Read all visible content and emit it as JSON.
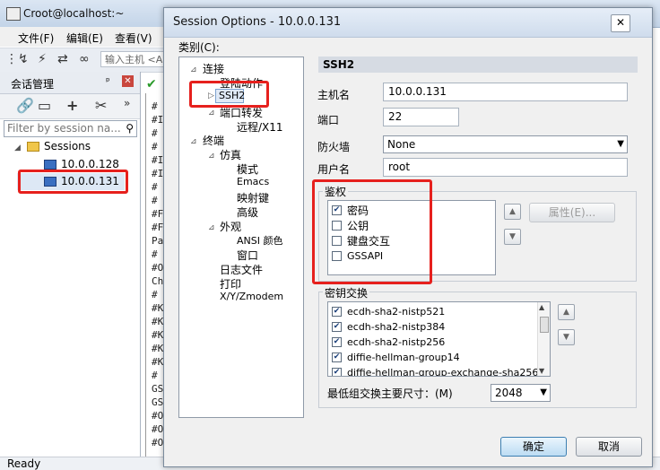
{
  "bg_window": {
    "title": "Croot@localhost:~",
    "menu": [
      "文件(F)",
      "编辑(E)",
      "查看(V)"
    ],
    "address_placeholder": "输入主机 <A",
    "session_panel_title": "会话管理",
    "filter_placeholder": "Filter by session na...",
    "sessions_root": "Sessions",
    "sessions": [
      "10.0.0.128",
      "10.0.0.131"
    ],
    "terminal_lines": [
      "#",
      "#I",
      "#",
      "#",
      "#I",
      "#I",
      "#",
      "#",
      "#F",
      "#F",
      "Pa",
      "#",
      "#O",
      "Ch",
      "#",
      "#K",
      "#K",
      "#K",
      "#K",
      "#K",
      "#",
      "GS",
      "GS",
      "#O",
      "#O",
      "#O"
    ],
    "status": "Ready"
  },
  "dialog": {
    "title": "Session Options - 10.0.0.131",
    "close_glyph": "✕",
    "category_label": "类别(C):",
    "tree": [
      {
        "label": "连接",
        "level": 0,
        "toggle": "⊿"
      },
      {
        "label": "登陆动作",
        "level": 2
      },
      {
        "label": "SSH2",
        "level": 2,
        "selected": true,
        "toggle": "▷"
      },
      {
        "label": "端口转发",
        "level": 2,
        "toggle": "⊿"
      },
      {
        "label": "远程/X11",
        "level": 3
      },
      {
        "label": "终端",
        "level": 0,
        "toggle": "⊿"
      },
      {
        "label": "仿真",
        "level": 1,
        "toggle": "⊿"
      },
      {
        "label": "模式",
        "level": 3
      },
      {
        "label": "Emacs",
        "level": 3
      },
      {
        "label": "映射键",
        "level": 3
      },
      {
        "label": "高级",
        "level": 3
      },
      {
        "label": "外观",
        "level": 1,
        "toggle": "⊿"
      },
      {
        "label": "ANSI 颜色",
        "level": 3
      },
      {
        "label": "窗口",
        "level": 3
      },
      {
        "label": "日志文件",
        "level": 1
      },
      {
        "label": "打印",
        "level": 1
      },
      {
        "label": "X/Y/Zmodem",
        "level": 1
      }
    ],
    "section_title": "SSH2",
    "fields": {
      "hostname_label": "主机名",
      "hostname_value": "10.0.0.131",
      "port_label": "端口",
      "port_value": "22",
      "firewall_label": "防火墙",
      "firewall_value": "None",
      "username_label": "用户名",
      "username_value": "root"
    },
    "auth": {
      "label": "鉴权",
      "items": [
        {
          "label": "密码",
          "checked": true
        },
        {
          "label": "公钥",
          "checked": false
        },
        {
          "label": "键盘交互",
          "checked": false
        },
        {
          "label": "GSSAPI",
          "checked": false
        }
      ],
      "properties_button": "属性(E)..."
    },
    "kex": {
      "label": "密钥交换",
      "items": [
        {
          "label": "ecdh-sha2-nistp521",
          "checked": true
        },
        {
          "label": "ecdh-sha2-nistp384",
          "checked": true
        },
        {
          "label": "ecdh-sha2-nistp256",
          "checked": true
        },
        {
          "label": "diffie-hellman-group14",
          "checked": true
        },
        {
          "label": "diffie-hellman-group-exchange-sha256",
          "checked": true
        }
      ],
      "min_group_label": "最低组交换主要尺寸：(M)",
      "min_group_value": "2048"
    },
    "ok": "确定",
    "cancel": "取消"
  },
  "icons": [
    "app-icon",
    "pin-icon",
    "close-icon",
    "link-icon",
    "properties-icon",
    "add-icon",
    "cut-icon",
    "more-icon",
    "search-icon",
    "folder-icon",
    "computer-icon",
    "check-icon",
    "arrow-up-icon",
    "arrow-down-icon",
    "dropdown-icon"
  ],
  "colors": {
    "highlight_red": "#e6201d",
    "selection": "#dfe9f6",
    "default_button": "#3c7fb1"
  }
}
